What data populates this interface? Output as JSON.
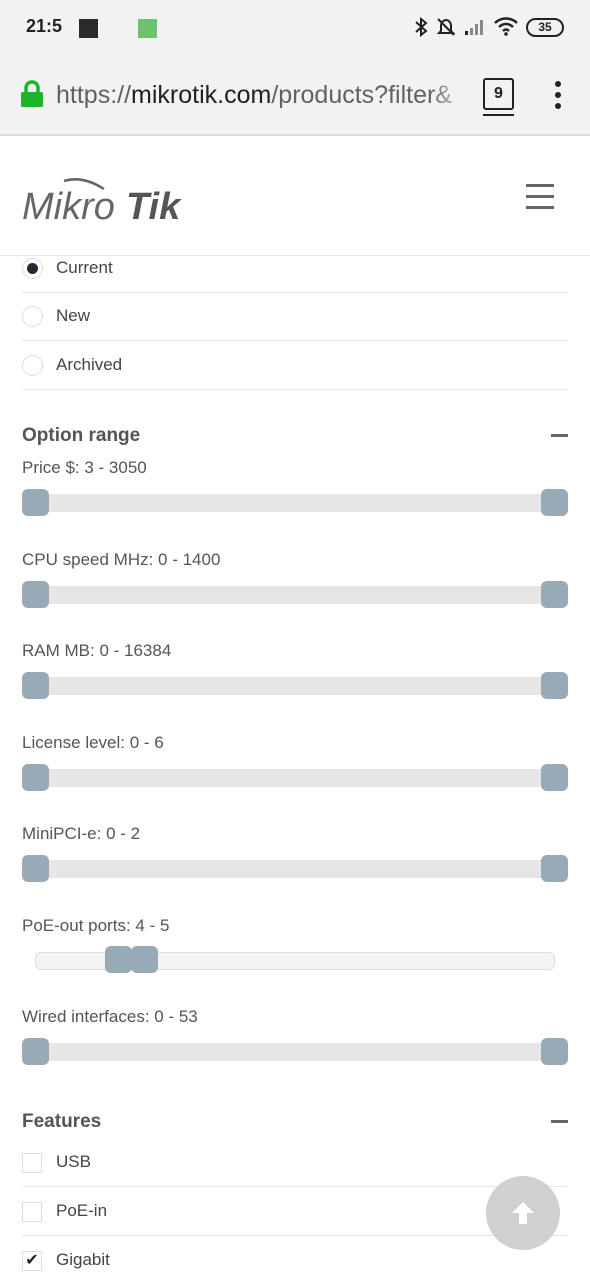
{
  "status_bar": {
    "time": "21:5",
    "battery": "35"
  },
  "browser": {
    "url_scheme": "https://",
    "url_host": "mikrotik.com",
    "url_path": "/products?filter&",
    "tab_count": "9"
  },
  "site": {
    "logo_text": "MikroTik"
  },
  "status_filter": {
    "options": [
      {
        "label": "Current",
        "checked": true
      },
      {
        "label": "New",
        "checked": false
      },
      {
        "label": "Archived",
        "checked": false
      }
    ]
  },
  "option_range": {
    "title": "Option range",
    "sliders": [
      {
        "label": "Price $: 3 - 3050",
        "low": 0,
        "high": 1
      },
      {
        "label": "CPU speed MHz: 0 - 1400",
        "low": 0,
        "high": 1
      },
      {
        "label": "RAM MB: 0 - 16384",
        "low": 0,
        "high": 1
      },
      {
        "label": "License level: 0 - 6",
        "low": 0,
        "high": 1
      },
      {
        "label": "MiniPCI-e: 0 - 2",
        "low": 0,
        "high": 1
      },
      {
        "label": "PoE-out ports: 4 - 5",
        "low": 0.16,
        "high": 0.21
      },
      {
        "label": "Wired interfaces: 0 - 53",
        "low": 0,
        "high": 1
      }
    ]
  },
  "features": {
    "title": "Features",
    "items": [
      {
        "label": "USB",
        "checked": false
      },
      {
        "label": "PoE-in",
        "checked": false
      },
      {
        "label": "Gigabit",
        "checked": true
      }
    ],
    "check_mark": "✔"
  },
  "colors": {
    "slider_handle": "#97aab6",
    "lock_green": "#1db32b"
  }
}
